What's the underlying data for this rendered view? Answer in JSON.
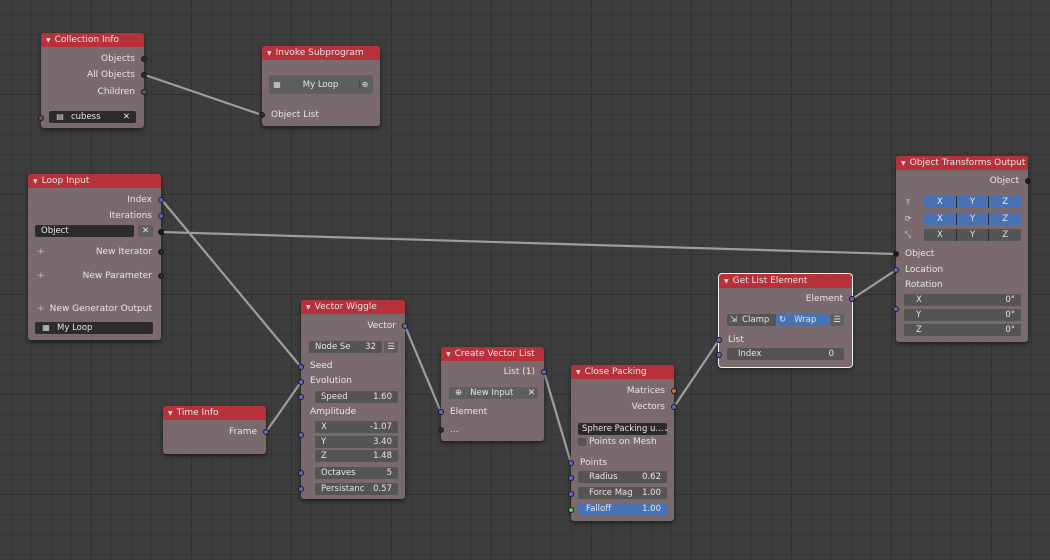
{
  "collection_info": {
    "title": "Collection Info",
    "outputs": [
      "Objects",
      "All Objects",
      "Children"
    ],
    "collection": "cubess"
  },
  "invoke_subprogram": {
    "title": "Invoke Subprogram",
    "program": "My Loop",
    "input": "Object List"
  },
  "loop_input": {
    "title": "Loop Input",
    "outputs": [
      "Index",
      "Iterations"
    ],
    "object_field": "Object",
    "new_iterator": "New Iterator",
    "new_parameter": "New Parameter",
    "new_generator_output": "New Generator Output",
    "loop_name": "My Loop"
  },
  "time_info": {
    "title": "Time Info",
    "output": "Frame"
  },
  "vector_wiggle": {
    "title": "Vector Wiggle",
    "output": "Vector",
    "node_setting": "Node Se",
    "node_setting_value": "32",
    "seed": "Seed",
    "evolution": "Evolution",
    "speed_label": "Speed",
    "speed_value": "1.60",
    "amplitude_label": "Amplitude",
    "x_label": "X",
    "x_value": "-1.07",
    "y_label": "Y",
    "y_value": "3.40",
    "z_label": "Z",
    "z_value": "1.48",
    "octaves_label": "Octaves",
    "octaves_value": "5",
    "persistance_label": "Persistanc",
    "persistance_value": "0.57"
  },
  "create_vector_list": {
    "title": "Create Vector List",
    "output": "List (1)",
    "new_input": "New Input",
    "element": "Element",
    "more": "..."
  },
  "close_packing": {
    "title": "Close Packing",
    "outputs": [
      "Matrices",
      "Vectors"
    ],
    "mode": "Sphere Packing u...",
    "points_on_mesh": "Points on Mesh",
    "points": "Points",
    "radius_label": "Radius",
    "radius_value": "0.62",
    "force_label": "Force Mag",
    "force_value": "1.00",
    "falloff_label": "Falloff",
    "falloff_value": "1.00"
  },
  "get_list_element": {
    "title": "Get List Element",
    "output": "Element",
    "clamp": "Clamp",
    "wrap": "Wrap",
    "list": "List",
    "index_label": "Index",
    "index_value": "0"
  },
  "object_transforms_output": {
    "title": "Object Transforms Output",
    "output": "Object",
    "axes": [
      "X",
      "Y",
      "Z"
    ],
    "inputs": [
      "Object",
      "Location",
      "Rotation"
    ],
    "rotation": [
      {
        "label": "X",
        "value": "0°"
      },
      {
        "label": "Y",
        "value": "0°"
      },
      {
        "label": "Z",
        "value": "0°"
      }
    ]
  },
  "colors": {
    "header": "#b7313b",
    "body": "#7a6a6e",
    "socket_vector": "#6363c7",
    "link": "#a3a3a3",
    "highlight": "#4772b3"
  }
}
